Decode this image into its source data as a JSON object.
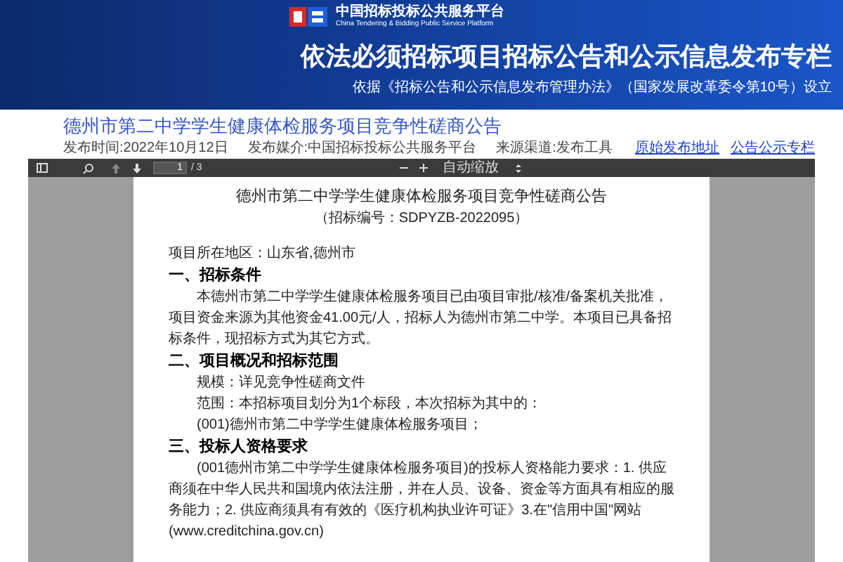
{
  "header": {
    "logo_cn": "中国招标投标公共服务平台",
    "logo_en": "China Tendering & Bidding Public Service Platform",
    "title": "依法必须招标项目招标公告和公示信息发布专栏",
    "basis": "依据《招标公告和公示信息发布管理办法》（国家发展改革委令第10号）设立"
  },
  "notice": {
    "title": "德州市第二中学学生健康体检服务项目竞争性磋商公告",
    "meta": [
      "发布时间:2022年10月12日",
      "发布媒介:中国招标投标公共服务平台",
      "来源渠道:发布工具"
    ],
    "links": [
      "原始发布地址",
      "公告公示专栏"
    ]
  },
  "viewer": {
    "toolbar": {
      "page": "1",
      "page_total": "/ 3",
      "zoom": "自动缩放"
    },
    "document": {
      "title": "德州市第二中学学生健康体检服务项目竞争性磋商公告",
      "code": "（招标编号：SDPYZB-2022095）",
      "blocks": [
        {
          "kind": "line",
          "text": "项目所在地区：山东省,德州市"
        },
        {
          "kind": "heading",
          "text": "一、招标条件"
        },
        {
          "kind": "paragraph",
          "text": "本德州市第二中学学生健康体检服务项目已由项目审批/核准/备案机关批准，项目资金来源为其他资金41.00元/人，招标人为德州市第二中学。本项目已具备招标条件，现招标方式为其它方式。"
        },
        {
          "kind": "heading",
          "text": "二、项目概况和招标范围"
        },
        {
          "kind": "indent",
          "text": "规模：详见竞争性磋商文件"
        },
        {
          "kind": "indent",
          "text": "范围：本招标项目划分为1个标段，本次招标为其中的："
        },
        {
          "kind": "indent",
          "text": "(001)德州市第二中学学生健康体检服务项目；"
        },
        {
          "kind": "heading",
          "text": "三、投标人资格要求"
        },
        {
          "kind": "paragraph",
          "text": "(001德州市第二中学学生健康体检服务项目)的投标人资格能力要求：1. 供应商须在中华人民共和国境内依法注册，并在人员、设备、资金等方面具有相应的服务能力；2. 供应商须具有有效的《医疗机构执业许可证》3.在\"信用中国\"网站(www.creditchina.gov.cn)"
        }
      ]
    }
  }
}
